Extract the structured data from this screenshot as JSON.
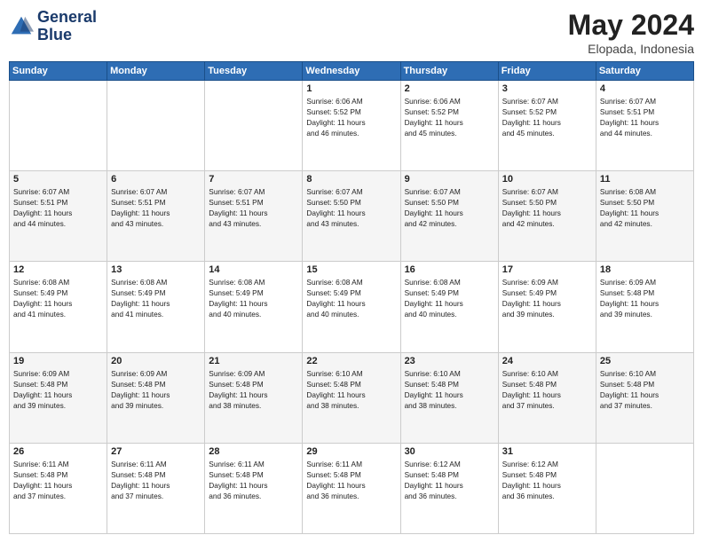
{
  "logo": {
    "line1": "General",
    "line2": "Blue"
  },
  "header": {
    "month": "May 2024",
    "location": "Elopada, Indonesia"
  },
  "days_of_week": [
    "Sunday",
    "Monday",
    "Tuesday",
    "Wednesday",
    "Thursday",
    "Friday",
    "Saturday"
  ],
  "weeks": [
    [
      {
        "day": "",
        "info": ""
      },
      {
        "day": "",
        "info": ""
      },
      {
        "day": "",
        "info": ""
      },
      {
        "day": "1",
        "info": "Sunrise: 6:06 AM\nSunset: 5:52 PM\nDaylight: 11 hours\nand 46 minutes."
      },
      {
        "day": "2",
        "info": "Sunrise: 6:06 AM\nSunset: 5:52 PM\nDaylight: 11 hours\nand 45 minutes."
      },
      {
        "day": "3",
        "info": "Sunrise: 6:07 AM\nSunset: 5:52 PM\nDaylight: 11 hours\nand 45 minutes."
      },
      {
        "day": "4",
        "info": "Sunrise: 6:07 AM\nSunset: 5:51 PM\nDaylight: 11 hours\nand 44 minutes."
      }
    ],
    [
      {
        "day": "5",
        "info": "Sunrise: 6:07 AM\nSunset: 5:51 PM\nDaylight: 11 hours\nand 44 minutes."
      },
      {
        "day": "6",
        "info": "Sunrise: 6:07 AM\nSunset: 5:51 PM\nDaylight: 11 hours\nand 43 minutes."
      },
      {
        "day": "7",
        "info": "Sunrise: 6:07 AM\nSunset: 5:51 PM\nDaylight: 11 hours\nand 43 minutes."
      },
      {
        "day": "8",
        "info": "Sunrise: 6:07 AM\nSunset: 5:50 PM\nDaylight: 11 hours\nand 43 minutes."
      },
      {
        "day": "9",
        "info": "Sunrise: 6:07 AM\nSunset: 5:50 PM\nDaylight: 11 hours\nand 42 minutes."
      },
      {
        "day": "10",
        "info": "Sunrise: 6:07 AM\nSunset: 5:50 PM\nDaylight: 11 hours\nand 42 minutes."
      },
      {
        "day": "11",
        "info": "Sunrise: 6:08 AM\nSunset: 5:50 PM\nDaylight: 11 hours\nand 42 minutes."
      }
    ],
    [
      {
        "day": "12",
        "info": "Sunrise: 6:08 AM\nSunset: 5:49 PM\nDaylight: 11 hours\nand 41 minutes."
      },
      {
        "day": "13",
        "info": "Sunrise: 6:08 AM\nSunset: 5:49 PM\nDaylight: 11 hours\nand 41 minutes."
      },
      {
        "day": "14",
        "info": "Sunrise: 6:08 AM\nSunset: 5:49 PM\nDaylight: 11 hours\nand 40 minutes."
      },
      {
        "day": "15",
        "info": "Sunrise: 6:08 AM\nSunset: 5:49 PM\nDaylight: 11 hours\nand 40 minutes."
      },
      {
        "day": "16",
        "info": "Sunrise: 6:08 AM\nSunset: 5:49 PM\nDaylight: 11 hours\nand 40 minutes."
      },
      {
        "day": "17",
        "info": "Sunrise: 6:09 AM\nSunset: 5:49 PM\nDaylight: 11 hours\nand 39 minutes."
      },
      {
        "day": "18",
        "info": "Sunrise: 6:09 AM\nSunset: 5:48 PM\nDaylight: 11 hours\nand 39 minutes."
      }
    ],
    [
      {
        "day": "19",
        "info": "Sunrise: 6:09 AM\nSunset: 5:48 PM\nDaylight: 11 hours\nand 39 minutes."
      },
      {
        "day": "20",
        "info": "Sunrise: 6:09 AM\nSunset: 5:48 PM\nDaylight: 11 hours\nand 39 minutes."
      },
      {
        "day": "21",
        "info": "Sunrise: 6:09 AM\nSunset: 5:48 PM\nDaylight: 11 hours\nand 38 minutes."
      },
      {
        "day": "22",
        "info": "Sunrise: 6:10 AM\nSunset: 5:48 PM\nDaylight: 11 hours\nand 38 minutes."
      },
      {
        "day": "23",
        "info": "Sunrise: 6:10 AM\nSunset: 5:48 PM\nDaylight: 11 hours\nand 38 minutes."
      },
      {
        "day": "24",
        "info": "Sunrise: 6:10 AM\nSunset: 5:48 PM\nDaylight: 11 hours\nand 37 minutes."
      },
      {
        "day": "25",
        "info": "Sunrise: 6:10 AM\nSunset: 5:48 PM\nDaylight: 11 hours\nand 37 minutes."
      }
    ],
    [
      {
        "day": "26",
        "info": "Sunrise: 6:11 AM\nSunset: 5:48 PM\nDaylight: 11 hours\nand 37 minutes."
      },
      {
        "day": "27",
        "info": "Sunrise: 6:11 AM\nSunset: 5:48 PM\nDaylight: 11 hours\nand 37 minutes."
      },
      {
        "day": "28",
        "info": "Sunrise: 6:11 AM\nSunset: 5:48 PM\nDaylight: 11 hours\nand 36 minutes."
      },
      {
        "day": "29",
        "info": "Sunrise: 6:11 AM\nSunset: 5:48 PM\nDaylight: 11 hours\nand 36 minutes."
      },
      {
        "day": "30",
        "info": "Sunrise: 6:12 AM\nSunset: 5:48 PM\nDaylight: 11 hours\nand 36 minutes."
      },
      {
        "day": "31",
        "info": "Sunrise: 6:12 AM\nSunset: 5:48 PM\nDaylight: 11 hours\nand 36 minutes."
      },
      {
        "day": "",
        "info": ""
      }
    ]
  ]
}
